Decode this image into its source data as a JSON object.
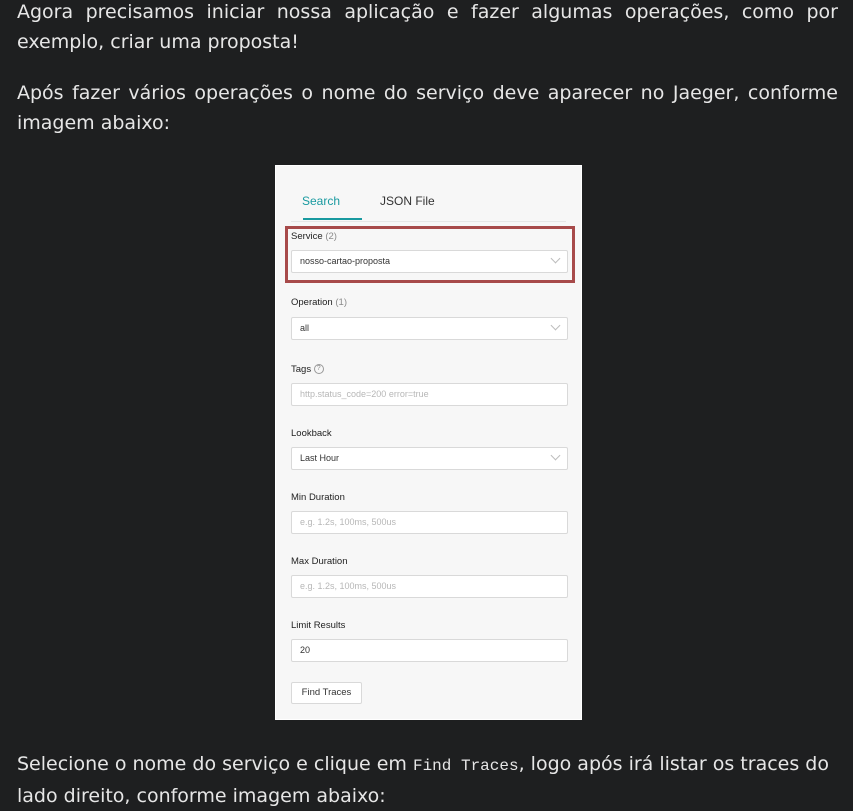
{
  "article": {
    "p1": "Agora precisamos iniciar nossa aplicação e fazer algumas operações, como por exemplo, criar uma proposta!",
    "p2": "Após fazer vários operações o nome do serviço deve aparecer no Jaeger, conforme imagem abaixo:",
    "p3_before": "Selecione o nome do serviço e clique em ",
    "p3_code": "Find Traces",
    "p3_after": ", logo após irá listar os traces do lado direito, conforme imagem abaixo:"
  },
  "jaeger": {
    "tabs": [
      "Search",
      "JSON File"
    ],
    "active_tab": "Search",
    "service": {
      "label": "Service",
      "count": "(2)",
      "value": "nosso-cartao-proposta"
    },
    "operation": {
      "label": "Operation",
      "count": "(1)",
      "value": "all"
    },
    "tags": {
      "label": "Tags",
      "help": "?",
      "placeholder": "http.status_code=200 error=true"
    },
    "lookback": {
      "label": "Lookback",
      "value": "Last Hour"
    },
    "min_duration": {
      "label": "Min Duration",
      "placeholder": "e.g. 1.2s, 100ms, 500us"
    },
    "max_duration": {
      "label": "Max Duration",
      "placeholder": "e.g. 1.2s, 100ms, 500us"
    },
    "limit": {
      "label": "Limit Results",
      "value": "20"
    },
    "find_button": "Find Traces",
    "highlight_color": "#a74a4a",
    "accent": "#199aa0"
  }
}
